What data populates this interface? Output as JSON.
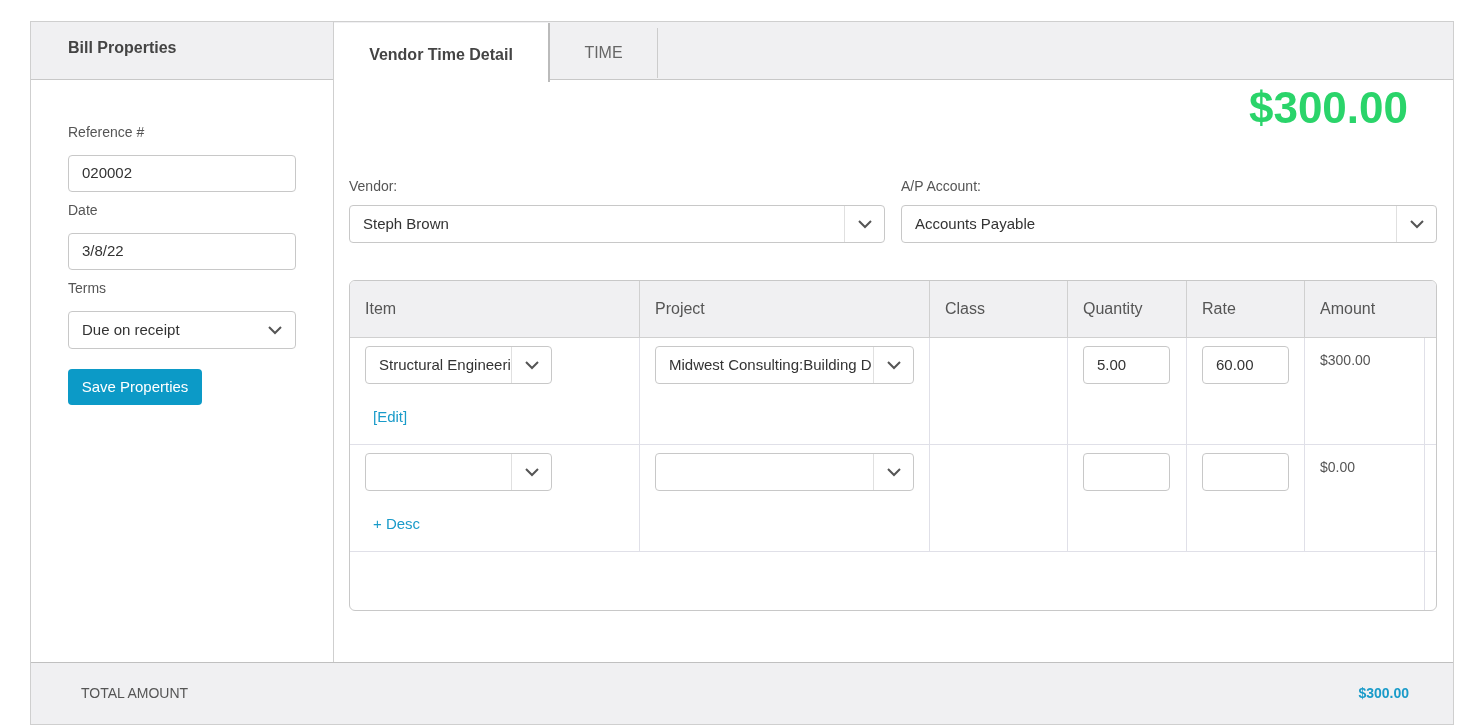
{
  "properties_panel": {
    "title": "Bill Properties",
    "fields": [
      {
        "label": "Reference #",
        "kind": "text",
        "value": "020002"
      },
      {
        "label": "Date",
        "kind": "text",
        "value": "3/8/22"
      },
      {
        "label": "Terms",
        "kind": "select",
        "value": "Due on receipt"
      }
    ],
    "save_button": "Save Properties"
  },
  "tabs": [
    {
      "label": "Vendor Time Detail",
      "selected": true
    },
    {
      "label": "TIME",
      "selected": false
    }
  ],
  "total_display": "$300.00",
  "vendor": {
    "label": "Vendor:",
    "value": "Steph Brown"
  },
  "ap_account": {
    "label": "A/P Account:",
    "value": "Accounts Payable"
  },
  "table": {
    "columns": [
      "Item",
      "Project",
      "Class",
      "Quantity",
      "Rate",
      "Amount"
    ],
    "rows": [
      {
        "item": "Structural Engineeri",
        "link": "[Edit]",
        "project": "Midwest Consulting:Building D",
        "quantity": "5.00",
        "rate": "60.00",
        "amount": "$300.00"
      },
      {
        "link": "+ Desc",
        "amount": "$0.00"
      }
    ]
  },
  "footer": {
    "label": "TOTAL AMOUNT",
    "amount": "$300.00"
  }
}
